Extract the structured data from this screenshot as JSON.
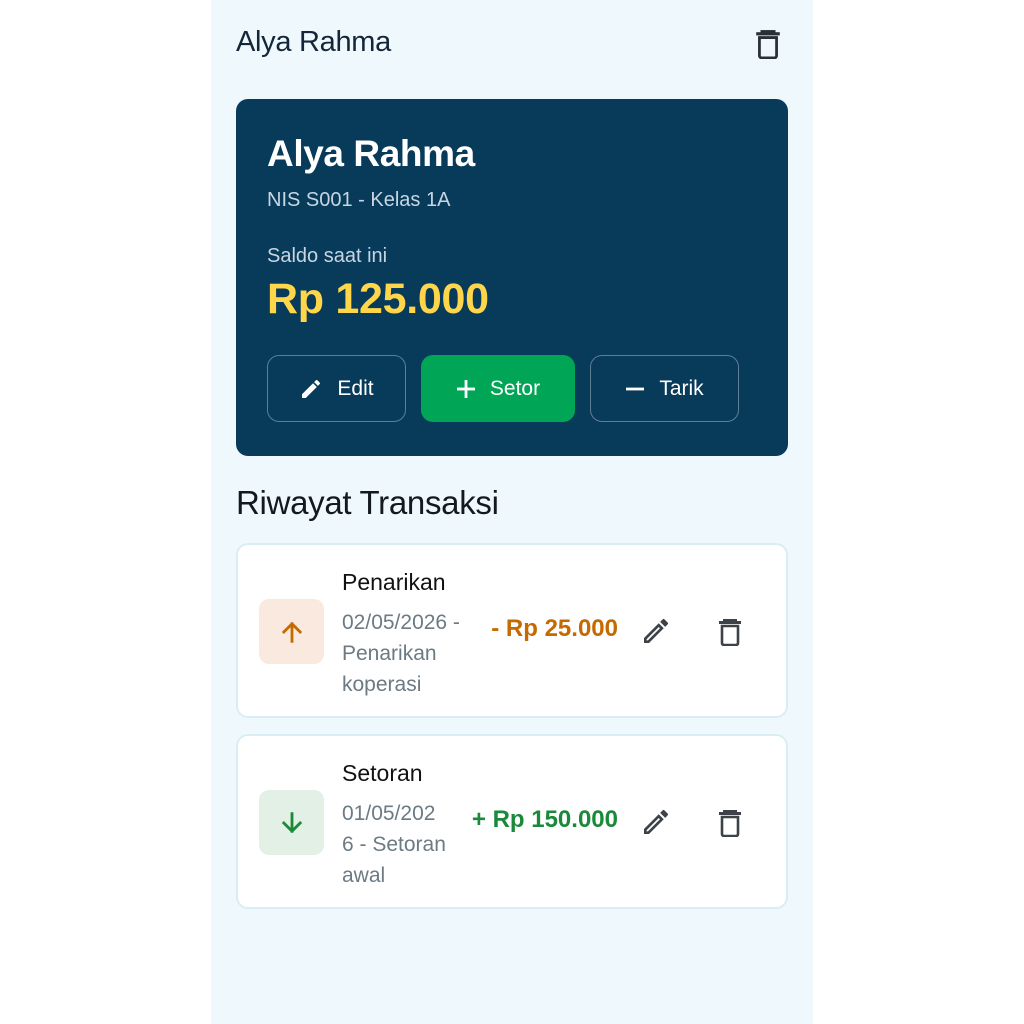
{
  "appbar": {
    "title": "Alya Rahma",
    "delete_icon": "trash-icon"
  },
  "student_card": {
    "name": "Alya Rahma",
    "subtitle": "NIS S001 - Kelas 1A",
    "balance_label": "Saldo saat ini",
    "balance": "Rp 125.000",
    "buttons": {
      "edit": {
        "label": "Edit",
        "icon": "pencil-icon"
      },
      "setor": {
        "label": "Setor",
        "icon": "plus-icon"
      },
      "tarik": {
        "label": "Tarik",
        "icon": "minus-icon"
      }
    }
  },
  "history": {
    "title": "Riwayat Transaksi",
    "items": [
      {
        "type": "withdrawal",
        "title": "Penarikan",
        "description": "02/05/2026 -\nPenarikan\nkoperasi",
        "amount": "- Rp 25.000",
        "icon": "arrow-up-icon"
      },
      {
        "type": "deposit",
        "title": "Setoran",
        "description": "01/05/202\n6 - Setoran\nawal",
        "amount": "+ Rp 150.000",
        "icon": "arrow-down-icon"
      }
    ]
  },
  "colors": {
    "background": "#eff8fc",
    "card": "#083a5a",
    "balance": "#ffd54a",
    "setor_button": "#00a656",
    "withdrawal": "#c46a00",
    "deposit": "#1a8a3a"
  }
}
